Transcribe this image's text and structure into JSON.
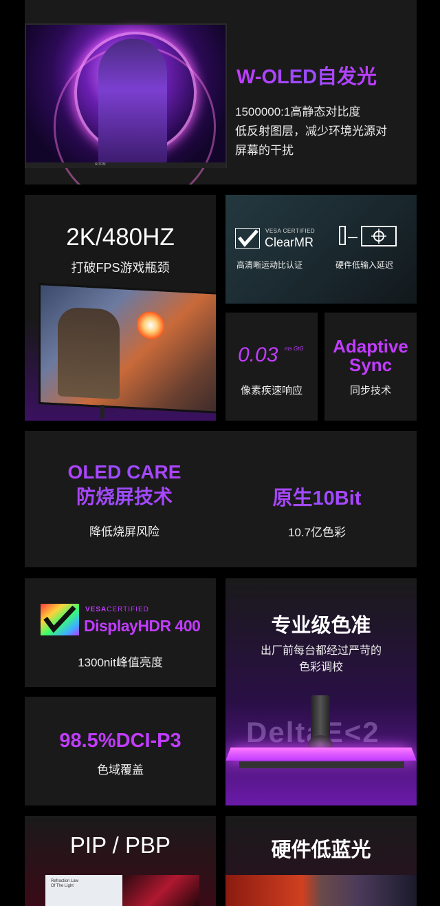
{
  "oled": {
    "title": "W-OLED自发光",
    "line1": "1500000:1高静态对比度",
    "line2": "低反射图层，减少环境光源对",
    "line3": "屏幕的干扰",
    "brand_mark": "ROOM"
  },
  "refresh": {
    "title": "2K/480HZ",
    "subtitle": "打破FPS游戏瓶颈"
  },
  "clearmr": {
    "cert": "VESA CERTIFIED",
    "name": "ClearMR",
    "label_left": "高清晰运动比认证",
    "label_right": "硬件低输入延迟"
  },
  "response": {
    "value": "0.03",
    "unit": "ms GtG",
    "label": "像素疾速响应"
  },
  "adaptive": {
    "line1": "Adaptive",
    "line2": "Sync",
    "label": "同步技术"
  },
  "care": {
    "line1": "OLED CARE",
    "line2": "防烧屏技术",
    "label": "降低烧屏风险",
    "bit_title": "原生10Bit",
    "bit_label": "10.7亿色彩"
  },
  "hdr": {
    "vesa": "VESA",
    "certified": "CERTIFIED",
    "name": "DisplayHDR 400",
    "label": "1300nit峰值亮度"
  },
  "dci": {
    "title": "98.5%DCI-P3",
    "label": "色域覆盖"
  },
  "calib": {
    "title": "专业级色准",
    "line1": "出厂前每台都经过严苛的",
    "line2": "色彩调校",
    "delta": "DeltaE<2"
  },
  "pip": {
    "title": "PIP / PBP",
    "doc_line1": "Refraction Law",
    "doc_line2": "Of The Light"
  },
  "bluelight": {
    "title": "硬件低蓝光"
  },
  "colors": {
    "accent": "#c13cff",
    "card": "#1a1a1a",
    "background": "#000000"
  }
}
